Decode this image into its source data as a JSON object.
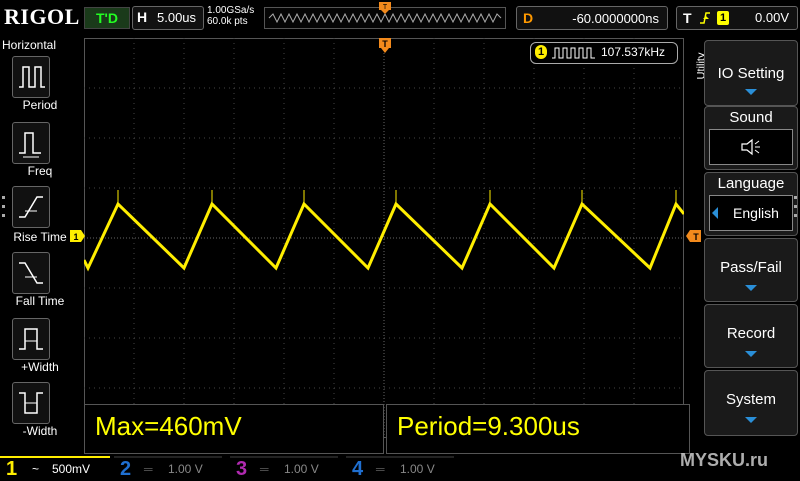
{
  "header": {
    "logo": "RIGOL",
    "run_state": "T'D",
    "horizontal_key": "H",
    "horizontal_scale": "5.00us",
    "sample_rate": "1.00GSa/s",
    "memory_depth": "60.0k pts",
    "delay_key": "D",
    "delay_value": "-60.0000000ns",
    "trigger_key": "T",
    "trigger_channel": "1",
    "trigger_level": "0.00V"
  },
  "left_menu": {
    "title": "Horizontal",
    "items": [
      "Period",
      "Freq",
      "Rise Time",
      "Fall Time",
      "+Width",
      "-Width"
    ]
  },
  "right_menu": {
    "group_label": "Utility",
    "buttons": [
      {
        "label": "IO Setting"
      },
      {
        "label": "Sound"
      },
      {
        "label": "Language",
        "value": "English"
      },
      {
        "label": "Pass/Fail"
      },
      {
        "label": "Record"
      },
      {
        "label": "System"
      }
    ]
  },
  "frequency_counter": {
    "channel": "1",
    "value": "107.537kHz"
  },
  "markers": {
    "trigger_position": "T",
    "channel1": "1",
    "trigger_level": "T"
  },
  "measurements": [
    {
      "text": "Max=460mV"
    },
    {
      "text": "Period=9.300us"
    }
  ],
  "channels": [
    {
      "num": "1",
      "coupling": "~",
      "scale": "500mV",
      "color": "#ffee00",
      "active": true
    },
    {
      "num": "2",
      "coupling": "",
      "scale": "1.00 V",
      "color": "#1f6fd0",
      "active": false
    },
    {
      "num": "3",
      "coupling": "",
      "scale": "1.00 V",
      "color": "#b02ab0",
      "active": false
    },
    {
      "num": "4",
      "coupling": "",
      "scale": "1.00 V",
      "color": "#1f6fd0",
      "active": false
    }
  ],
  "watermark": "MYSKU.ru",
  "colors": {
    "trace": "#ffee00",
    "accent": "#f28a1c",
    "menu_arrow": "#2a8fd8"
  }
}
